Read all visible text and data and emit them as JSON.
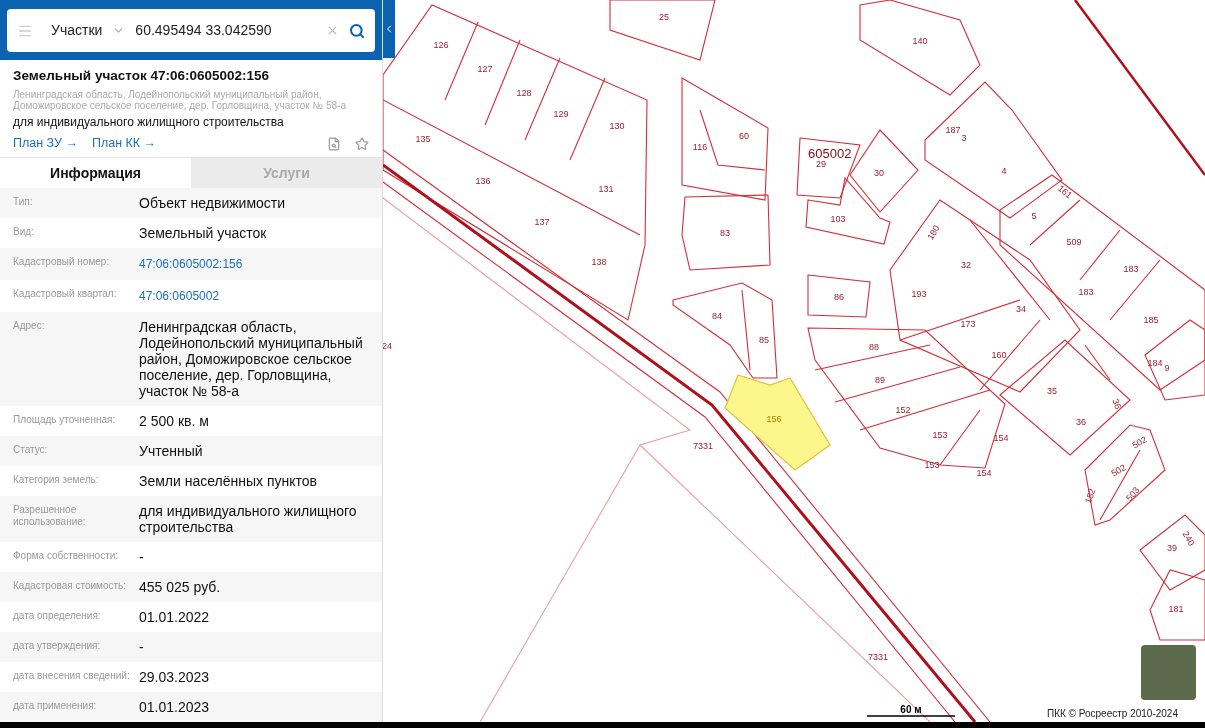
{
  "search": {
    "category": "Участки",
    "query": "60.495494 33.042590"
  },
  "object": {
    "title": "Земельный участок 47:06:0605002:156",
    "address": "Ленинградская область, Лодейнопольский муниципальный район, Доможировское сельское поселение, дер. Горловщина, участок № 58-а",
    "purpose": "для индивидуального жилищного строительства",
    "links": [
      "План ЗУ →",
      "План КК →"
    ]
  },
  "tabs": [
    {
      "label": "Информация",
      "selected": true
    },
    {
      "label": "Услуги",
      "selected": false
    }
  ],
  "rows": [
    {
      "label": "Тип:",
      "value": "Объект недвижимости",
      "kind": "text"
    },
    {
      "label": "Вид:",
      "value": "Земельный участок",
      "kind": "text"
    },
    {
      "label": "Кадастровый номер:",
      "value": "47:06:0605002:156",
      "kind": "link"
    },
    {
      "label": "Кадастровый квартал:",
      "value": "47:06:0605002",
      "kind": "link"
    },
    {
      "label": "Адрес:",
      "value": "Ленинградская область, Лодейнопольский муниципальный район, Доможировское сельское поселение, дер. Горловщина, участок № 58-а",
      "kind": "text"
    },
    {
      "label": "Площадь уточненная:",
      "value": "2 500 кв. м",
      "kind": "text"
    },
    {
      "label": "Статус:",
      "value": "Учтенный",
      "kind": "text"
    },
    {
      "label": "Категория земель:",
      "value": "Земли населённых пунктов",
      "kind": "text"
    },
    {
      "label": "Разрешенное использование:",
      "value": "для индивидуального жилищного строительства",
      "kind": "text"
    },
    {
      "label": "Форма собственности:",
      "value": "-",
      "kind": "text"
    },
    {
      "label": "Кадастровая стоимость:",
      "value": "455 025 руб.",
      "kind": "text"
    },
    {
      "label": "дата определения:",
      "value": "01.01.2022",
      "kind": "text"
    },
    {
      "label": "дата утверждения:",
      "value": "-",
      "kind": "text"
    },
    {
      "label": "дата внесения сведений:",
      "value": "29.03.2023",
      "kind": "text"
    },
    {
      "label": "дата применения:",
      "value": "01.01.2023",
      "kind": "text"
    }
  ],
  "map": {
    "quarter": "605002",
    "parcels": [
      {
        "label": "25",
        "selected": false
      },
      {
        "label": "126",
        "selected": false
      },
      {
        "label": "127",
        "selected": false
      },
      {
        "label": "128",
        "selected": false
      },
      {
        "label": "129",
        "selected": false
      },
      {
        "label": "130",
        "selected": false
      },
      {
        "label": "140",
        "selected": false
      },
      {
        "label": "135",
        "selected": false
      },
      {
        "label": "116",
        "selected": false
      },
      {
        "label": "60",
        "selected": false
      },
      {
        "label": "29",
        "selected": false
      },
      {
        "label": "30",
        "selected": false
      },
      {
        "label": "187",
        "selected": false
      },
      {
        "label": "3",
        "selected": false
      },
      {
        "label": "4",
        "selected": false
      },
      {
        "label": "136",
        "selected": false
      },
      {
        "label": "131",
        "selected": false
      },
      {
        "label": "161",
        "selected": false
      },
      {
        "label": "5",
        "selected": false
      },
      {
        "label": "137",
        "selected": false
      },
      {
        "label": "103",
        "selected": false
      },
      {
        "label": "509",
        "selected": false
      },
      {
        "label": "83",
        "selected": false
      },
      {
        "label": "180",
        "selected": false
      },
      {
        "label": "32",
        "selected": false
      },
      {
        "label": "183",
        "selected": false
      },
      {
        "label": "183",
        "selected": false
      },
      {
        "label": "138",
        "selected": false
      },
      {
        "label": "86",
        "selected": false
      },
      {
        "label": "193",
        "selected": false
      },
      {
        "label": "34",
        "selected": false
      },
      {
        "label": "84",
        "selected": false
      },
      {
        "label": "173",
        "selected": false
      },
      {
        "label": "185",
        "selected": false
      },
      {
        "label": "85",
        "selected": false
      },
      {
        "label": "24",
        "selected": false
      },
      {
        "label": "88",
        "selected": false
      },
      {
        "label": "160",
        "selected": false
      },
      {
        "label": "184",
        "selected": false
      },
      {
        "label": "9",
        "selected": false
      },
      {
        "label": "89",
        "selected": false
      },
      {
        "label": "35",
        "selected": false
      },
      {
        "label": "36",
        "selected": false
      },
      {
        "label": "36",
        "selected": false
      },
      {
        "label": "156",
        "selected": true
      },
      {
        "label": "7331",
        "selected": false
      },
      {
        "label": "152",
        "selected": false
      },
      {
        "label": "153",
        "selected": false
      },
      {
        "label": "154",
        "selected": false
      },
      {
        "label": "153",
        "selected": false
      },
      {
        "label": "154",
        "selected": false
      },
      {
        "label": "502",
        "selected": false
      },
      {
        "label": "502",
        "selected": false
      },
      {
        "label": "182",
        "selected": false
      },
      {
        "label": "503",
        "selected": false
      },
      {
        "label": "39",
        "selected": false
      },
      {
        "label": "240",
        "selected": false
      },
      {
        "label": "181",
        "selected": false
      },
      {
        "label": "7331",
        "selected": false
      }
    ],
    "scale": "60 м",
    "copyright": "ПКК © Росреестр 2010-2024"
  }
}
